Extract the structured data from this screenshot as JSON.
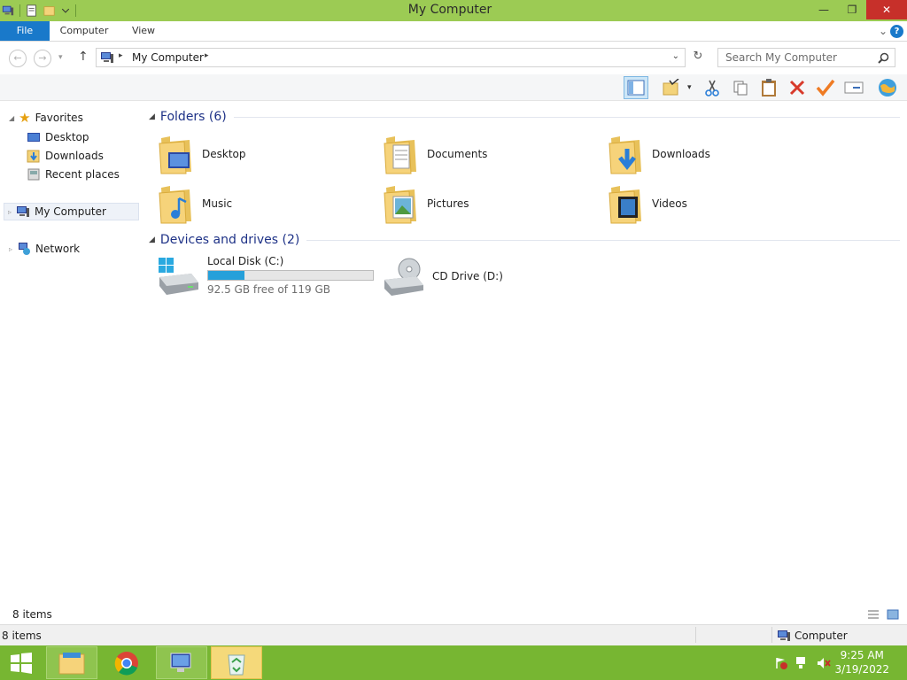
{
  "window": {
    "title": "My Computer"
  },
  "ribbon": {
    "tabs": [
      "File",
      "Computer",
      "View"
    ],
    "expand": "⌄",
    "help": "?"
  },
  "address": {
    "path": "My Computer"
  },
  "search": {
    "placeholder": "Search My Computer"
  },
  "sidebar": {
    "favorites": "Favorites",
    "items": [
      "Desktop",
      "Downloads",
      "Recent places"
    ],
    "computer": "My Computer",
    "network": "Network"
  },
  "folders": {
    "header": "Folders (6)",
    "items": [
      "Desktop",
      "Documents",
      "Downloads",
      "Music",
      "Pictures",
      "Videos"
    ]
  },
  "drives": {
    "header": "Devices and drives (2)",
    "local": {
      "name": "Local Disk (C:)",
      "free": "92.5 GB free of 119 GB",
      "used_fraction": 0.22
    },
    "cd": {
      "name": "CD Drive (D:)"
    }
  },
  "status": {
    "items_inner": "8 items",
    "items_outer": "8 items",
    "location": "Computer"
  },
  "clock": {
    "time": "9:25 AM",
    "date": "3/19/2022"
  },
  "colors": {
    "titlebar": "#9ccb54",
    "taskbar": "#77b632",
    "accent": "#1979ca",
    "progress": "#26a0da",
    "close": "#c7302a"
  }
}
